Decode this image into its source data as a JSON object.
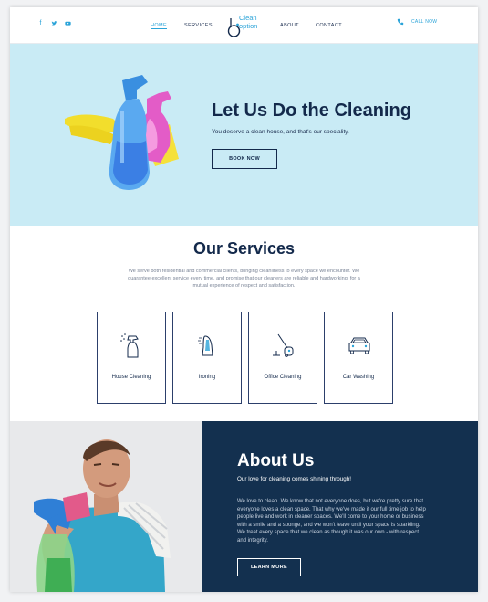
{
  "header": {
    "social": [
      "facebook-icon",
      "twitter-icon",
      "youtube-icon"
    ],
    "nav": {
      "home": "HOME",
      "services": "SERVICES",
      "about": "ABOUT",
      "contact": "CONTACT"
    },
    "logo": {
      "line1": "Clean",
      "line2": "option"
    },
    "call": "CALL NOW"
  },
  "hero": {
    "title": "Let Us Do the Cleaning",
    "subtitle": "You deserve a clean house, and that's our speciality.",
    "button": "BOOK NOW"
  },
  "services": {
    "title": "Our Services",
    "description": "We serve both residential and commercial clients, bringing cleanliness to every space we encounter. We guarantee excellent service every time, and promise that our cleaners are reliable and hardworking, for a mutual experience of respect and satisfaction.",
    "cards": [
      {
        "label": "House Cleaning",
        "icon": "spray-bottle-icon"
      },
      {
        "label": "Ironing",
        "icon": "iron-icon"
      },
      {
        "label": "Office Cleaning",
        "icon": "vacuum-icon"
      },
      {
        "label": "Car Washing",
        "icon": "car-icon"
      }
    ]
  },
  "about": {
    "title": "About Us",
    "subtitle": "Our love for cleaning comes shining through!",
    "body": "We love to clean. We know that not everyone does, but we're pretty sure that everyone loves a clean space. That why we've made it our full time job to help people live and work in cleaner spaces. We'll come to your home or business with a smile and a sponge, and we won't leave until your space is sparkling. We treat every space that we clean as though it was our own - with respect and integrity.",
    "button": "LEARN MORE"
  },
  "colors": {
    "accent": "#2aa3d8",
    "navy": "#13294b",
    "hero_bg": "#c9ebf5",
    "about_bg": "#13304f"
  }
}
